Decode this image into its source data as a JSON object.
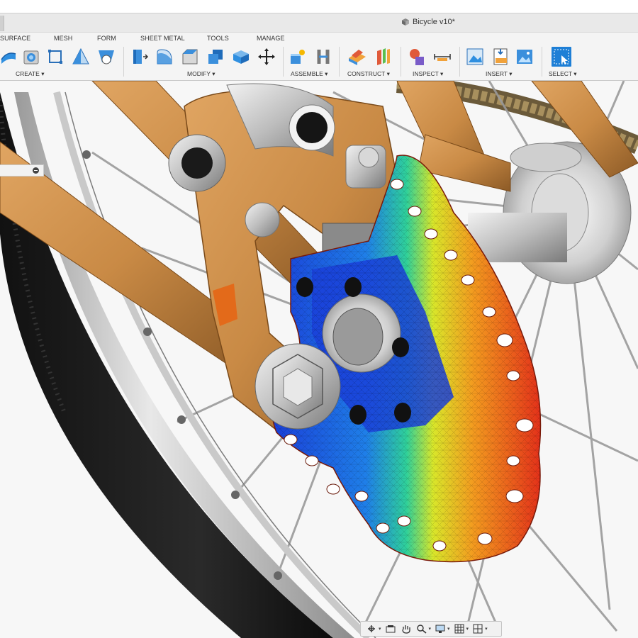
{
  "window": {
    "document_title": "Bicycle v10*"
  },
  "workspace_tabs": [
    "SURFACE",
    "MESH",
    "FORM",
    "SHEET METAL",
    "TOOLS",
    "MANAGE"
  ],
  "toolbar_groups": {
    "create": "CREATE ▾",
    "modify": "MODIFY ▾",
    "assemble": "ASSEMBLE ▾",
    "construct": "CONSTRUCT ▾",
    "inspect": "INSPECT ▾",
    "insert": "INSERT ▾",
    "select": "SELECT ▾"
  },
  "colors": {
    "accent_blue": "#1e7fd6",
    "frame_copper": "#c98a45",
    "stress_high": "#e8391c",
    "stress_low": "#1a4fe0"
  },
  "icons": {
    "create": [
      "extrude-icon",
      "revolve-icon",
      "sketch-rectangle-icon",
      "loft-icon",
      "sweep-icon"
    ],
    "modify": [
      "press-pull-icon",
      "fillet-icon",
      "chamfer-icon",
      "combine-icon",
      "split-body-icon",
      "move-icon"
    ],
    "assemble": [
      "new-component-icon",
      "joint-icon"
    ],
    "construct": [
      "offset-plane-icon",
      "midplane-icon"
    ],
    "inspect": [
      "interference-icon",
      "measure-icon"
    ],
    "insert": [
      "insert-decal-icon",
      "insert-svg-icon",
      "insert-canvas-icon"
    ],
    "select": [
      "select-icon"
    ],
    "navbar": [
      "orbit-icon",
      "look-at-icon",
      "pan-icon",
      "zoom-icon",
      "display-settings-icon",
      "grid-icon",
      "viewports-icon"
    ]
  }
}
